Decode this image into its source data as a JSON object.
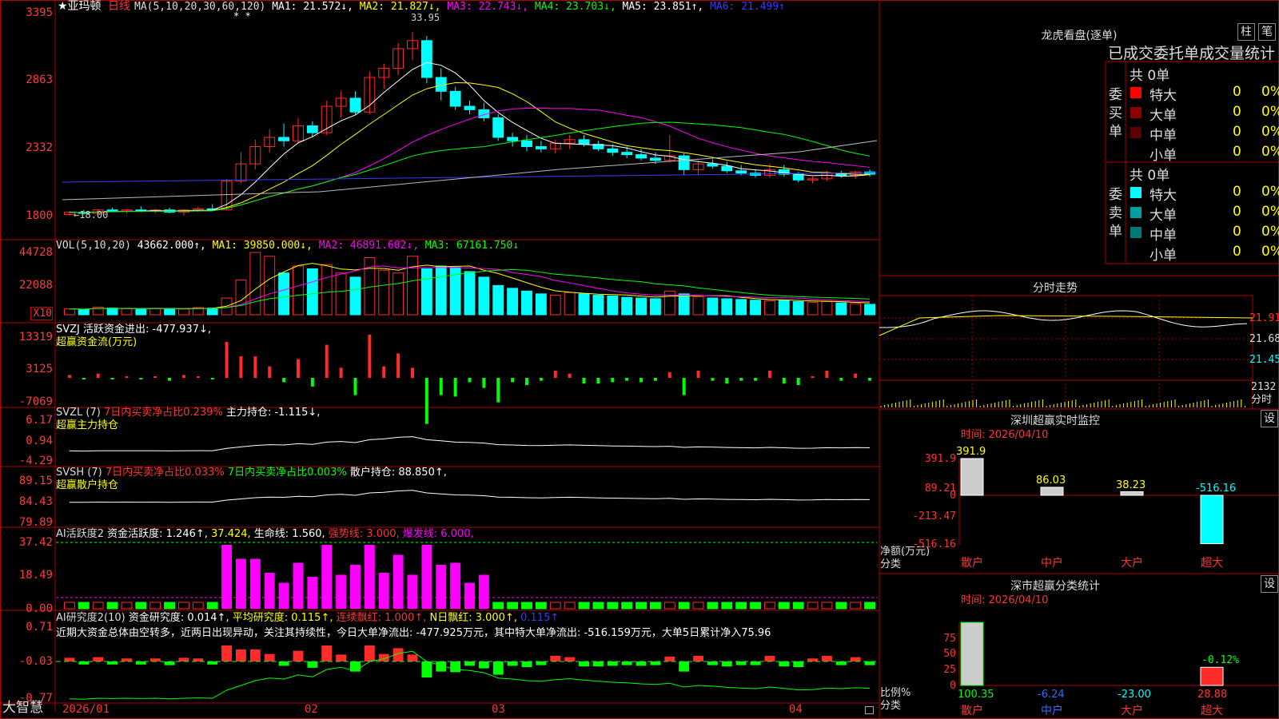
{
  "stock": {
    "star_name": "★亚玛顿",
    "period": "日线"
  },
  "header_row1": [
    {
      "text": "MA(5,10,20,30,60,120)",
      "color": "#dddddd"
    },
    {
      "text": "MA1: 21.572↓,",
      "color": "#ffffff"
    },
    {
      "text": "MA2: 21.827↓,",
      "color": "#ffff00"
    },
    {
      "text": "MA3: 22.743↓,",
      "color": "#ff00ff"
    },
    {
      "text": "MA4: 23.703↓,",
      "color": "#00ff00"
    },
    {
      "text": "MA5: 23.851↑,",
      "color": "#ffffff"
    },
    {
      "text": "MA6: 21.499↑",
      "color": "#3a3aff"
    }
  ],
  "price_axis": [
    "3395",
    "2863",
    "2332",
    "1800"
  ],
  "price_notes": {
    "high": "33.95",
    "low": "←18.00",
    "stars": "* *"
  },
  "vol_header": [
    {
      "text": "VOL(5,10,20)",
      "color": "#dddddd"
    },
    {
      "text": "43662.000↑,",
      "color": "#ffffff"
    },
    {
      "text": "MA1: 39850.000↓,",
      "color": "#ffff00"
    },
    {
      "text": "MA2: 46891.602↓,",
      "color": "#ff00ff"
    },
    {
      "text": "MA3: 67161.750↓",
      "color": "#00ff00"
    }
  ],
  "vol_axis": [
    "44728",
    "22088",
    "X10"
  ],
  "svzj": {
    "line1": "SVZJ  活跃资金进出: -477.937↓,",
    "line2": "超赢资金流(万元)",
    "axis": [
      "13319",
      "3125",
      "-7069"
    ]
  },
  "svzl": {
    "line1a": "SVZL (7)",
    "line1b": "7日内买卖净占比0.239%",
    "line1c": "主力持仓: -1.115↓,",
    "line2": "超赢主力持仓",
    "axis": [
      "6.17",
      "0.94",
      "-4.29"
    ]
  },
  "svsh": {
    "line1a": "SVSH (7)",
    "line1b": "7日内买卖净占比0.033%",
    "line1c": "7日内买卖净占比0.003%",
    "line1d": "散户持仓: 88.850↑,",
    "line2": "超赢散户持仓",
    "axis": [
      "89.15",
      "84.43",
      "79.89"
    ]
  },
  "ai_active": {
    "segs": [
      {
        "text": "AI活跃度2",
        "color": "#dddddd"
      },
      {
        "text": "资金活跃度: 1.246↑,",
        "color": "#ffffff"
      },
      {
        "text": "37.424,",
        "color": "#ffff00"
      },
      {
        "text": "生命线: 1.560,",
        "color": "#ffffff"
      },
      {
        "text": "强势线: 3.000,",
        "color": "#ff3333"
      },
      {
        "text": "爆发线: 6.000,",
        "color": "#ff00ff"
      }
    ],
    "axis": [
      "37.42",
      "18.49",
      "0.00"
    ]
  },
  "ai_research": {
    "segs": [
      {
        "text": "AI研究度2(10)",
        "color": "#dddddd"
      },
      {
        "text": "资金研究度: 0.014↑,",
        "color": "#ffffff"
      },
      {
        "text": "平均研究度: 0.115↑,",
        "color": "#ffff00"
      },
      {
        "text": "连续飘红: 1.000↑,",
        "color": "#ff3333"
      },
      {
        "text": "N日飘红: 3.000↑,",
        "color": "#ffff00"
      },
      {
        "text": "0.115↑",
        "color": "#3a3aff"
      }
    ],
    "note": "近期大资金总体由空转多，近两日出现异动，关注其持续性，今日大单净流出: -477.925万元，其中特大单净流出: -516.159万元，大单5日累计净入75.96",
    "axis": [
      "0.71",
      "-0.03",
      "-0.77"
    ]
  },
  "date_axis": [
    "2026/01",
    "02",
    "03",
    "04"
  ],
  "brand": "大智慧",
  "lhb": {
    "title": "龙虎看盘(逐单)",
    "btn1": "柱",
    "btn2": "笔",
    "subtitle": "已成交委托单成交量统计",
    "buy_label": "委买单",
    "sell_label": "委卖单",
    "buy_total": "共 0单",
    "sell_total": "共 0单",
    "buy_rows": [
      {
        "name": "特大",
        "count": "0",
        "pct": "0%",
        "color": "#ff0000"
      },
      {
        "name": "大单",
        "count": "0",
        "pct": "0%",
        "color": "#8b0000"
      },
      {
        "name": "中单",
        "count": "0",
        "pct": "0%",
        "color": "#5a0000"
      },
      {
        "name": "小单",
        "count": "0",
        "pct": "0%",
        "color": ""
      }
    ],
    "sell_rows": [
      {
        "name": "特大",
        "count": "0",
        "pct": "0%",
        "color": "#00ffff"
      },
      {
        "name": "大单",
        "count": "0",
        "pct": "0%",
        "color": "#00a0a0"
      },
      {
        "name": "中单",
        "count": "0",
        "pct": "0%",
        "color": "#007878"
      },
      {
        "name": "小单",
        "count": "0",
        "pct": "0%",
        "color": ""
      }
    ]
  },
  "intraday": {
    "title": "分时走势",
    "axis": [
      "21.91",
      "21.68",
      "21.45"
    ],
    "vol_label": "2132",
    "vol_unit": "分时"
  },
  "sz_monitor": {
    "title": "深圳超赢实时监控",
    "set": "设",
    "time": "时间: 2026/04/10",
    "axis": [
      "391.9",
      "89.21",
      "0",
      "-213.47",
      "-516.16"
    ],
    "footer1": "净额(万元)",
    "footer2": "分类",
    "categories": [
      "散户",
      "中户",
      "大户",
      "超大"
    ],
    "values": [
      391.9,
      86.03,
      38.23,
      -516.16
    ],
    "value_labels": [
      "391.9",
      "86.03",
      "38.23",
      "-516.16"
    ]
  },
  "sz_category": {
    "title": "深市超赢分类统计",
    "set": "设",
    "time": "时间: 2026/04/10",
    "axis": [
      "75",
      "50",
      "25",
      "0"
    ],
    "footer1": "比例%",
    "footer2": "分类",
    "categories": [
      "散户",
      "中户",
      "大户",
      "超大"
    ],
    "values": [
      100.35,
      -6.24,
      -23.0,
      28.88
    ],
    "value_labels": [
      "100.35",
      "-6.24",
      "-23.00",
      "28.88"
    ],
    "note": "-0.12%"
  },
  "chart_data": [
    {
      "type": "candlestick",
      "title": "亚玛顿 日线",
      "candles": [
        [
          18.1,
          18.4,
          18.0,
          18.3
        ],
        [
          18.3,
          18.5,
          18.1,
          18.2
        ],
        [
          18.2,
          18.6,
          18.1,
          18.5
        ],
        [
          18.5,
          18.7,
          18.3,
          18.4
        ],
        [
          18.4,
          18.6,
          18.2,
          18.5
        ],
        [
          18.5,
          18.8,
          18.3,
          18.4
        ],
        [
          18.4,
          18.6,
          18.2,
          18.5
        ],
        [
          18.5,
          18.7,
          18.2,
          18.3
        ],
        [
          18.3,
          18.6,
          18.0,
          18.5
        ],
        [
          18.5,
          18.8,
          18.3,
          18.6
        ],
        [
          18.6,
          19.0,
          18.4,
          18.5
        ],
        [
          18.5,
          21.2,
          18.5,
          21.0
        ],
        [
          21.0,
          23.5,
          20.8,
          22.5
        ],
        [
          22.5,
          24.6,
          22.0,
          24.0
        ],
        [
          24.0,
          25.5,
          23.5,
          24.8
        ],
        [
          24.8,
          26.0,
          24.0,
          24.5
        ],
        [
          24.5,
          26.5,
          24.3,
          25.8
        ],
        [
          25.8,
          26.2,
          24.8,
          25.2
        ],
        [
          25.2,
          28.0,
          25.0,
          27.5
        ],
        [
          27.5,
          28.8,
          26.5,
          28.2
        ],
        [
          28.2,
          28.8,
          26.8,
          27.0
        ],
        [
          27.0,
          30.5,
          26.8,
          30.0
        ],
        [
          30.0,
          31.2,
          29.0,
          30.8
        ],
        [
          30.8,
          33.0,
          30.2,
          32.5
        ],
        [
          32.5,
          33.95,
          31.5,
          33.2
        ],
        [
          33.2,
          33.6,
          29.5,
          30.0
        ],
        [
          30.0,
          30.8,
          28.0,
          28.8
        ],
        [
          28.8,
          29.2,
          27.2,
          27.5
        ],
        [
          27.5,
          28.0,
          26.8,
          27.2
        ],
        [
          27.2,
          27.8,
          26.2,
          26.5
        ],
        [
          26.5,
          26.8,
          24.5,
          24.8
        ],
        [
          24.8,
          25.2,
          24.0,
          24.5
        ],
        [
          24.5,
          25.0,
          23.6,
          24.0
        ],
        [
          24.0,
          24.5,
          23.5,
          23.8
        ],
        [
          23.8,
          24.6,
          23.4,
          24.3
        ],
        [
          24.3,
          25.0,
          23.8,
          24.6
        ],
        [
          24.6,
          25.0,
          24.0,
          24.2
        ],
        [
          24.2,
          24.5,
          23.6,
          23.8
        ],
        [
          23.8,
          24.2,
          23.2,
          23.5
        ],
        [
          23.5,
          24.0,
          23.0,
          23.3
        ],
        [
          23.3,
          23.8,
          22.8,
          23.0
        ],
        [
          23.0,
          23.5,
          22.5,
          22.8
        ],
        [
          22.8,
          25.0,
          22.6,
          23.2
        ],
        [
          23.2,
          23.4,
          21.5,
          22.0
        ],
        [
          22.0,
          22.8,
          21.5,
          22.5
        ],
        [
          22.5,
          22.9,
          22.1,
          22.3
        ],
        [
          22.3,
          22.7,
          21.7,
          21.9
        ],
        [
          21.9,
          22.4,
          21.5,
          21.7
        ],
        [
          21.7,
          22.0,
          21.3,
          21.5
        ],
        [
          21.5,
          22.5,
          21.3,
          22.0
        ],
        [
          22.0,
          22.4,
          21.4,
          21.6
        ],
        [
          21.6,
          21.8,
          20.9,
          21.1
        ],
        [
          21.1,
          21.4,
          20.8,
          21.2
        ],
        [
          21.2,
          21.9,
          21.0,
          21.7
        ],
        [
          21.7,
          21.9,
          21.3,
          21.5
        ],
        [
          21.5,
          21.9,
          21.2,
          21.8
        ],
        [
          21.8,
          22.0,
          21.4,
          21.6
        ]
      ],
      "ylim": [
        17.5,
        34.5
      ]
    },
    {
      "type": "bar",
      "title": "VOL(5,10,20)",
      "values": [
        4200,
        3800,
        5500,
        4800,
        4300,
        3900,
        4500,
        4600,
        4100,
        5200,
        4800,
        12000,
        25000,
        44728,
        42000,
        30000,
        35000,
        33000,
        36000,
        30000,
        27000,
        41000,
        32000,
        30000,
        42000,
        33000,
        35000,
        34000,
        31000,
        27000,
        21000,
        19000,
        17000,
        15000,
        14000,
        16000,
        15000,
        14000,
        13500,
        12500,
        12000,
        11500,
        17000,
        15000,
        13000,
        12000,
        11500,
        11000,
        10500,
        10000,
        10500,
        9500,
        9000,
        9500,
        8500,
        8000,
        7500
      ],
      "ylim": [
        0,
        50000
      ]
    }
  ]
}
